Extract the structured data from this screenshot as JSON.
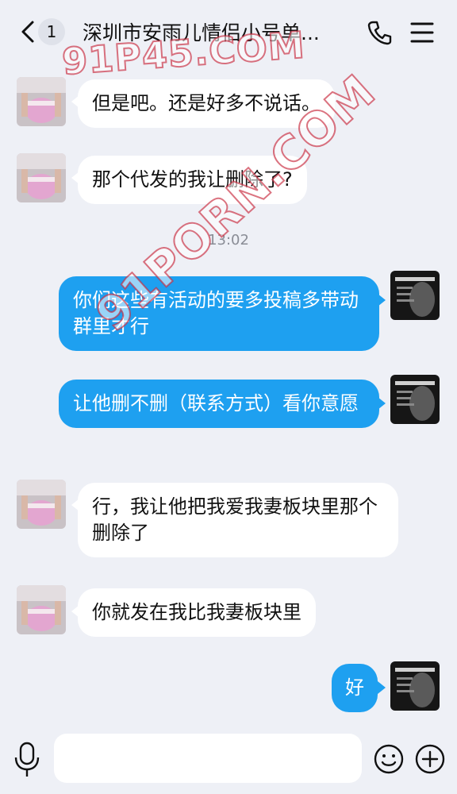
{
  "header": {
    "unread_count": "1",
    "title": "深圳市安雨儿情侣小号单..."
  },
  "timestamp": "13:02",
  "messages": [
    {
      "side": "in",
      "text": "但是吧。还是好多不说话。"
    },
    {
      "side": "in",
      "text": "那个代发的我让删除了?"
    },
    {
      "side": "out",
      "text": "你们这些有活动的要多投稿多带动群里才行"
    },
    {
      "side": "out",
      "text": "让他删不删（联系方式）看你意愿"
    },
    {
      "side": "in",
      "text": "行，我让他把我爱我妻板块里那个删除了"
    },
    {
      "side": "in",
      "text": "你就发在我比我妻板块里"
    },
    {
      "side": "out",
      "text": "好"
    }
  ],
  "input": {
    "placeholder": ""
  },
  "watermarks": [
    "91P45.COM",
    "91PORN.COM"
  ],
  "colors": {
    "background": "#eef0f6",
    "outgoing_bubble": "#1ea0f0",
    "incoming_bubble": "#ffffff",
    "timestamp": "#8a8d96"
  },
  "icons": [
    "back-arrow-icon",
    "phone-icon",
    "menu-icon",
    "microphone-icon",
    "emoji-icon",
    "plus-icon"
  ]
}
